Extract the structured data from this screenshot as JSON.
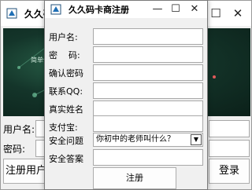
{
  "login_window": {
    "title": "久久码",
    "banner_text": "简单使",
    "username_label": "用户名:",
    "password_label": "密码:",
    "register_button": "注册用户",
    "login_button": "登录"
  },
  "register_window": {
    "title": "久久码卡商注册",
    "fields": {
      "username": "用户名:",
      "password": "密    码:",
      "confirm_password": "确认密码",
      "contact_qq": "联系QQ:",
      "real_name": "真实姓名",
      "alipay": "支付宝:",
      "security_question": "安全问题",
      "security_answer": "安全答案"
    },
    "security_question_value": "你初中的老师叫什么？",
    "register_button": "注册"
  },
  "icons": {
    "minimize": "minimize-icon",
    "maximize": "maximize-icon",
    "close": "close-icon",
    "app": "app-icon",
    "dropdown": "chevron-down-icon"
  }
}
